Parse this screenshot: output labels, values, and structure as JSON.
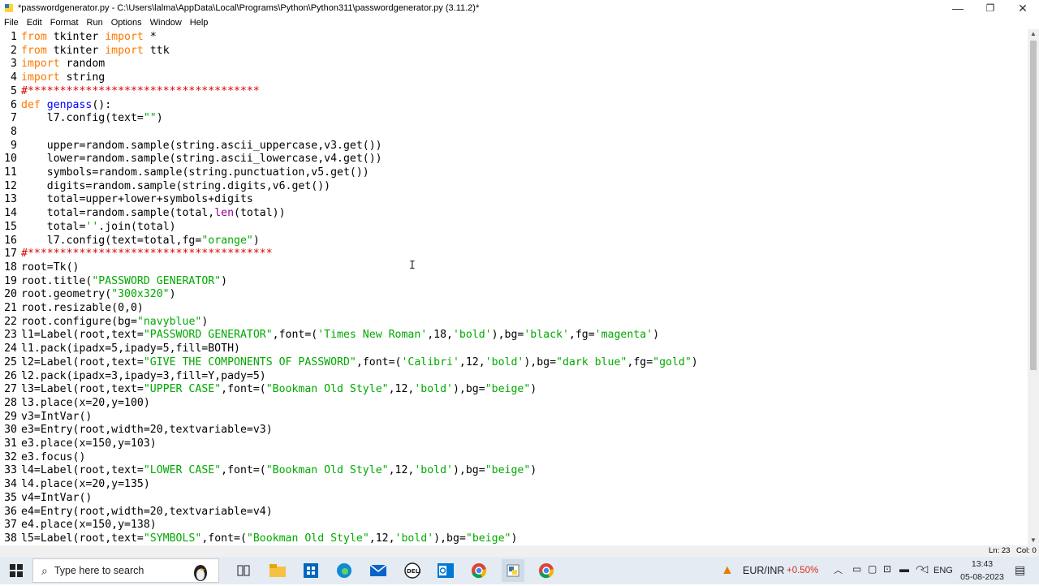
{
  "window": {
    "title": "*passwordgenerator.py - C:\\Users\\lalma\\AppData\\Local\\Programs\\Python\\Python311\\passwordgenerator.py (3.11.2)*",
    "minimize_glyph": "—",
    "maximize_glyph": "❐",
    "close_glyph": "✕"
  },
  "menu": [
    "File",
    "Edit",
    "Format",
    "Run",
    "Options",
    "Window",
    "Help"
  ],
  "code_lines": [
    "from tkinter import *",
    "from tkinter import ttk",
    "import random",
    "import string",
    "#************************************",
    "def genpass():",
    "    l7.config(text=\"\")",
    "",
    "    upper=random.sample(string.ascii_uppercase,v3.get())",
    "    lower=random.sample(string.ascii_lowercase,v4.get())",
    "    symbols=random.sample(string.punctuation,v5.get())",
    "    digits=random.sample(string.digits,v6.get())",
    "    total=upper+lower+symbols+digits",
    "    total=random.sample(total,len(total))",
    "    total=''.join(total)",
    "    l7.config(text=total,fg=\"orange\")",
    "#**************************************",
    "root=Tk()",
    "root.title(\"PASSWORD GENERATOR\")",
    "root.geometry(\"300x320\")",
    "root.resizable(0,0)",
    "root.configure(bg=\"navyblue\")",
    "l1=Label(root,text=\"PASSWORD GENERATOR\",font=('Times New Roman',18,'bold'),bg='black',fg='magenta')",
    "l1.pack(ipadx=5,ipady=5,fill=BOTH)",
    "l2=Label(root,text=\"GIVE THE COMPONENTS OF PASSWORD\",font=('Calibri',12,'bold'),bg=\"dark blue\",fg=\"gold\")",
    "l2.pack(ipadx=3,ipady=3,fill=Y,pady=5)",
    "l3=Label(root,text=\"UPPER CASE\",font=(\"Bookman Old Style\",12,'bold'),bg=\"beige\")",
    "l3.place(x=20,y=100)",
    "v3=IntVar()",
    "e3=Entry(root,width=20,textvariable=v3)",
    "e3.place(x=150,y=103)",
    "e3.focus()",
    "l4=Label(root,text=\"LOWER CASE\",font=(\"Bookman Old Style\",12,'bold'),bg=\"beige\")",
    "l4.place(x=20,y=135)",
    "v4=IntVar()",
    "e4=Entry(root,width=20,textvariable=v4)",
    "e4.place(x=150,y=138)",
    "l5=Label(root,text=\"SYMBOLS\",font=(\"Bookman Old Style\",12,'bold'),bg=\"beige\")"
  ],
  "status": {
    "line": "Ln: 23",
    "col": "Col: 0"
  },
  "taskbar": {
    "search_placeholder": "Type here to search",
    "stock_name": "EUR/INR",
    "stock_change": "+0.50%",
    "language": "ENG",
    "time": "13:43",
    "date": "05-08-2023"
  },
  "colors": {
    "keyword": "#ff7700",
    "builtin": "#900090",
    "string": "#00aa00",
    "comment": "#dd0000",
    "definition": "#0000ff",
    "stock_change": "#d93025"
  }
}
